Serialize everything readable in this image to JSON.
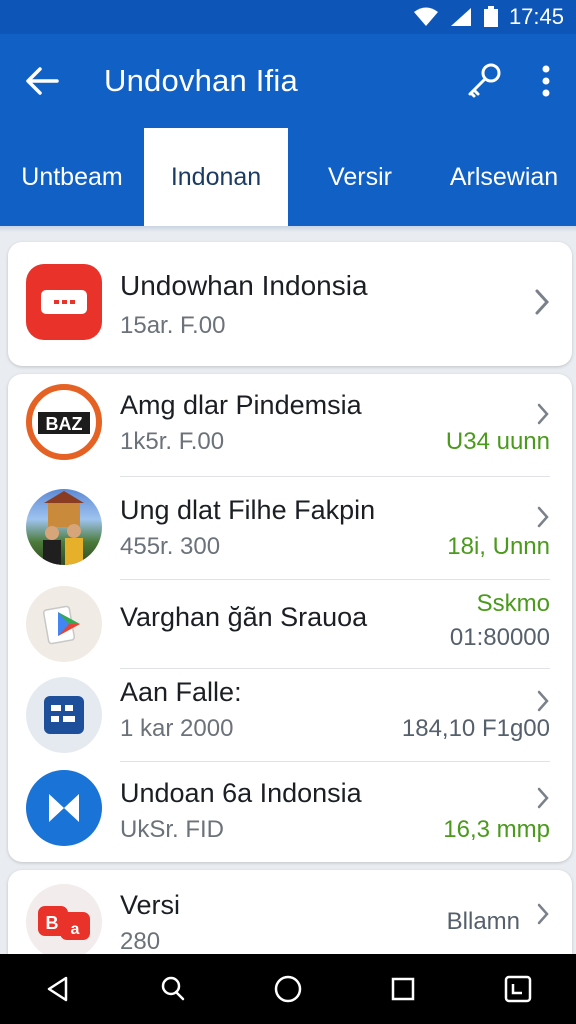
{
  "status_bar": {
    "time": "17:45"
  },
  "app_bar": {
    "title": "Undovhan Ifia"
  },
  "tabs": [
    {
      "label": "Untbeam",
      "active": false
    },
    {
      "label": "Indonan",
      "active": true
    },
    {
      "label": "Versir",
      "active": false
    },
    {
      "label": "Arlsewian",
      "active": false
    }
  ],
  "featured": {
    "name": "Undowhan Indonsia",
    "sub": "15ar. F.00",
    "icon": "video-player-icon",
    "color": "#e8322a"
  },
  "list": [
    {
      "name": "Amg dlar Pindemsia",
      "sub": "1k5r. F.00",
      "value": "U34 uunn",
      "icon": "badge-logo-icon"
    },
    {
      "name": "Ung dlat Filhe Fakpin",
      "sub": "455r. 300",
      "value": "18i, Unnn",
      "icon": "photo-avatar-icon"
    },
    {
      "name": "Varghan ğãn Srauoa",
      "sub": "01:80000",
      "value": "Sskmo",
      "icon": "play-store-icon"
    },
    {
      "name": "Aan Falle:",
      "sub": "1 kar 2000",
      "value": "184,10 F1g00",
      "icon": "document-icon"
    },
    {
      "name": "Undoan 6a Indonsia",
      "sub": "UkSr. FID",
      "value": "16,3 mmp",
      "icon": "media-play-icon"
    }
  ],
  "bottom": {
    "name": "Versi",
    "sub": "280",
    "value": "Bllamn",
    "icon": "translate-icon"
  },
  "colors": {
    "primary": "#1160c5",
    "accent_green": "#4a9a1c"
  }
}
